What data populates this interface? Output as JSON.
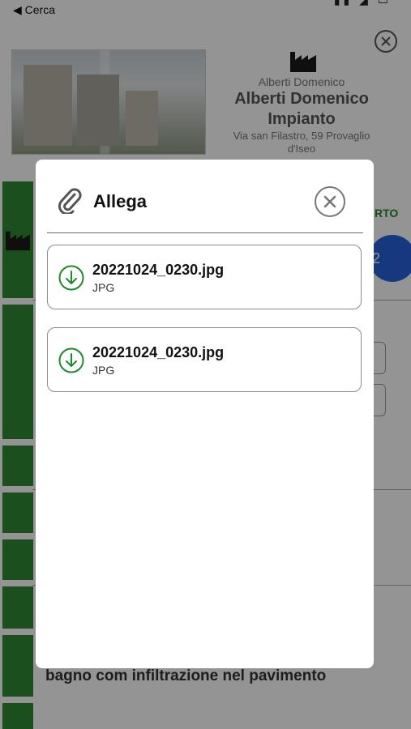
{
  "status_bar": {
    "back_label": "◀ Cerca"
  },
  "background": {
    "client_small": "Alberti Domenico",
    "client_name_line1": "Alberti Domenico",
    "client_name_line2": "Impianto",
    "address_line1": "Via san Filastro, 59 Provaglio",
    "address_line2": "d'Iseo",
    "status_partial": "RTO",
    "badge_partial": "2",
    "description_partial": "bagno com infiltrazione nel pavimento"
  },
  "modal": {
    "title": "Allega",
    "icon": "paperclip-icon",
    "close_icon": "close-circle-icon",
    "files": [
      {
        "name": "20221024_0230.jpg",
        "type": "JPG",
        "icon": "download-circle-icon"
      },
      {
        "name": "20221024_0230.jpg",
        "type": "JPG",
        "icon": "download-circle-icon"
      }
    ]
  },
  "colors": {
    "accent_green": "#1f8a2a",
    "brand_green": "#2f8a35",
    "badge_blue": "#2563d6",
    "overlay": "rgba(0,0,0,0.42)"
  }
}
